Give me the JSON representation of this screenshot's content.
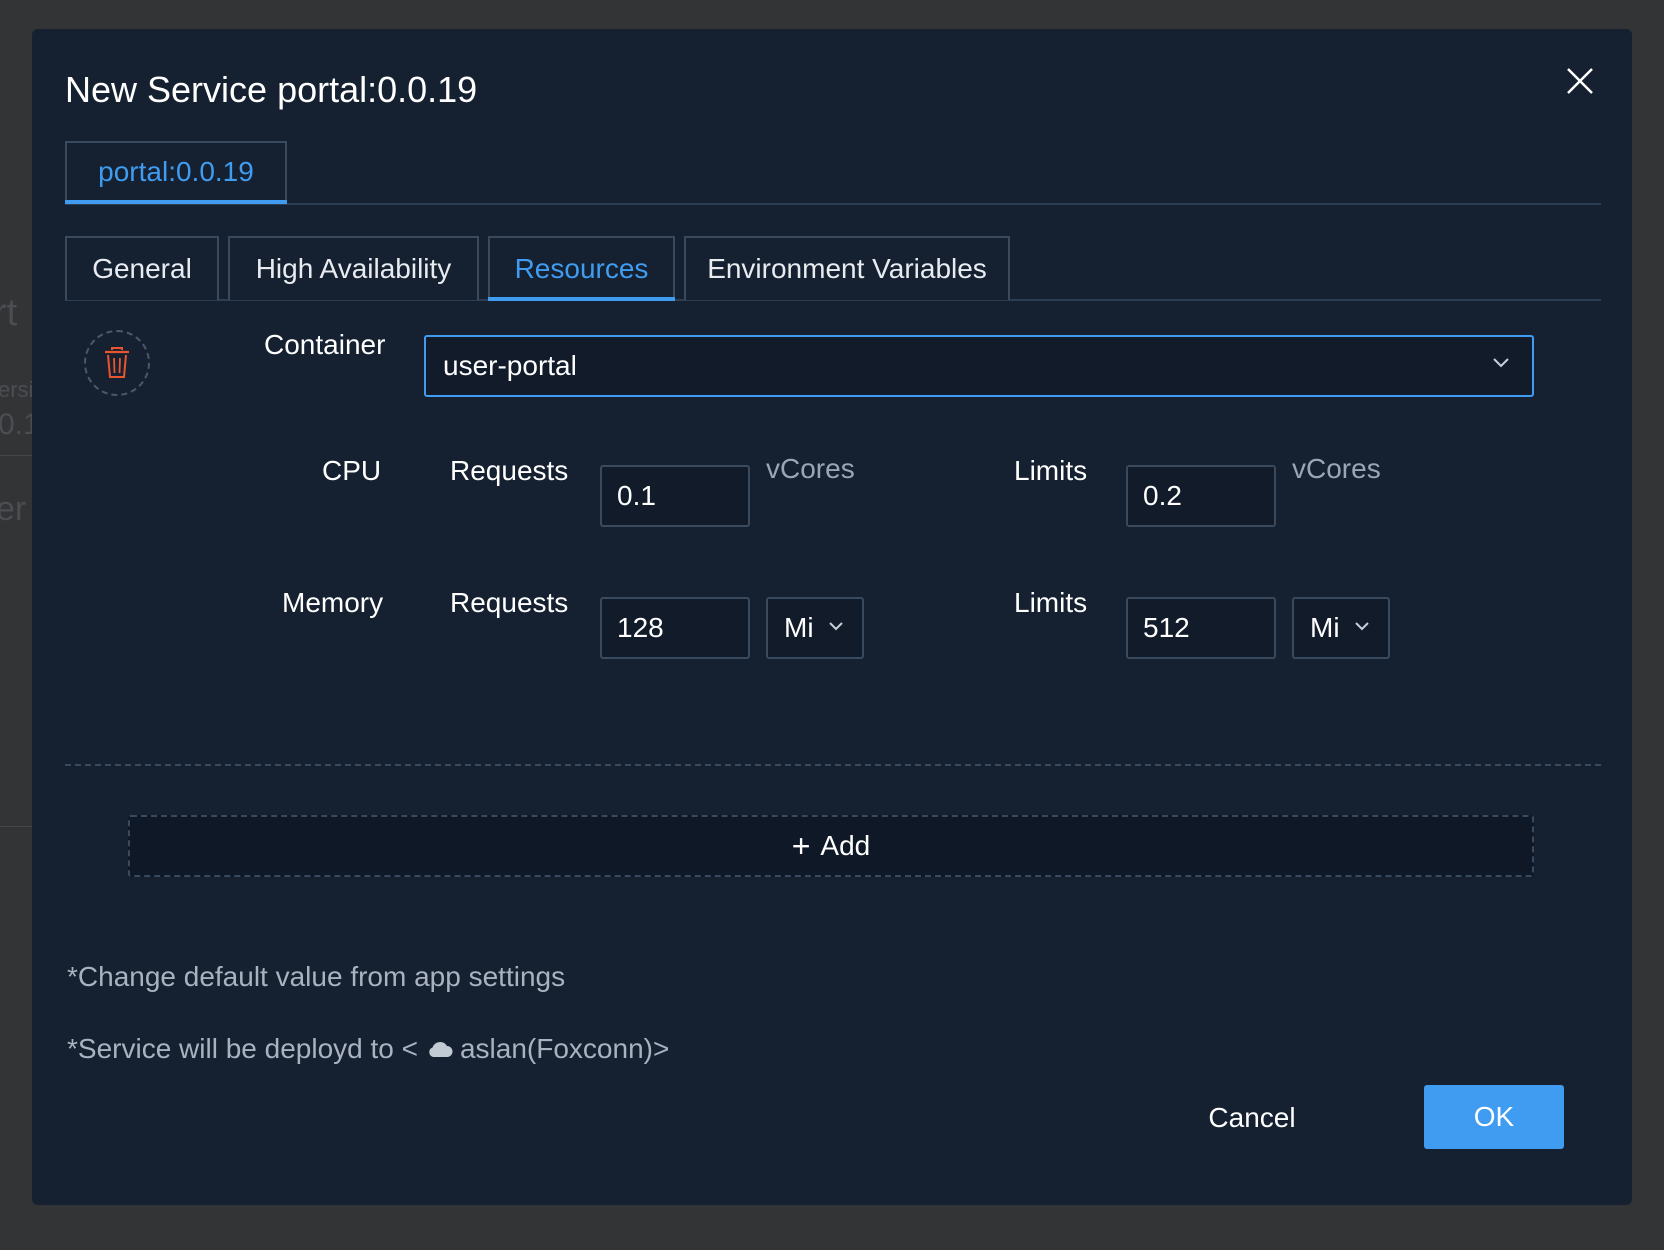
{
  "background": {
    "ghost_text_1": "rt",
    "ghost_text_2": "ersi",
    "ghost_text_3": "0.1",
    "ghost_text_4": "er"
  },
  "modal": {
    "title": "New Service portal:0.0.19",
    "close_icon": "close-icon"
  },
  "version_tab": {
    "label": "portal:0.0.19"
  },
  "tabs": [
    {
      "label": "General",
      "active": false
    },
    {
      "label": "High Availability",
      "active": false
    },
    {
      "label": "Resources",
      "active": true
    },
    {
      "label": "Environment Variables",
      "active": false
    }
  ],
  "resources": {
    "delete_icon": "trash-icon",
    "container_label": "Container",
    "container_value": "user-portal",
    "cpu": {
      "label": "CPU",
      "requests_label": "Requests",
      "requests_value": "0.1",
      "requests_unit": "vCores",
      "limits_label": "Limits",
      "limits_value": "0.2",
      "limits_unit": "vCores"
    },
    "memory": {
      "label": "Memory",
      "requests_label": "Requests",
      "requests_value": "128",
      "requests_unit": "Mi",
      "limits_label": "Limits",
      "limits_value": "512",
      "limits_unit": "Mi"
    },
    "add_label": "Add"
  },
  "notes": {
    "default_hint": "*Change default value from app settings",
    "deploy_prefix": "*Service will be deployd to <",
    "deploy_cluster": "aslan(Foxconn)>"
  },
  "footer": {
    "cancel_label": "Cancel",
    "ok_label": "OK"
  },
  "colors": {
    "accent": "#3f9cf0",
    "modal_bg": "#152030",
    "danger": "#e8552f"
  }
}
